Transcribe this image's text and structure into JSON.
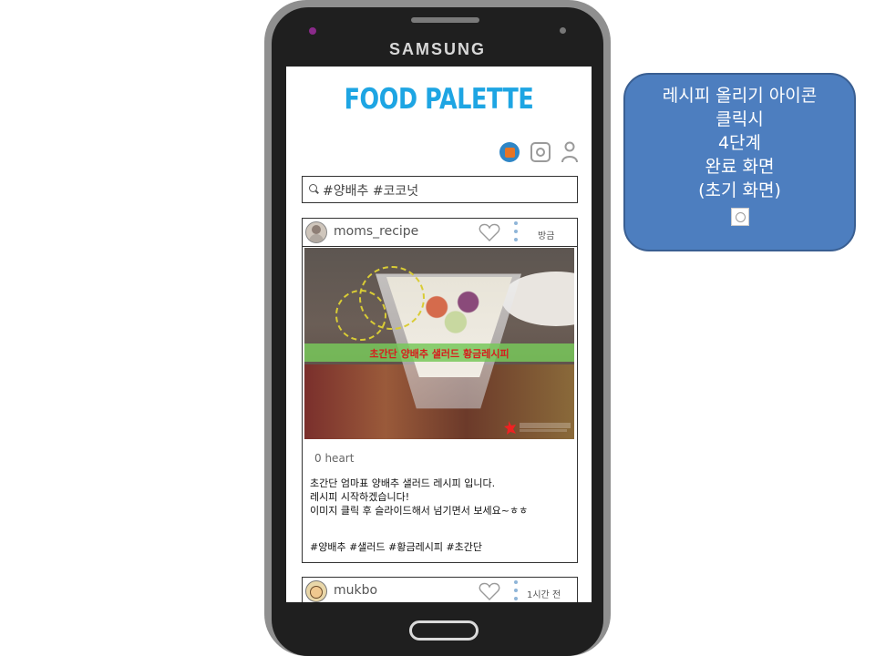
{
  "device": {
    "brand": "SAMSUNG"
  },
  "app": {
    "logo": "FOOD PALETTE",
    "search": {
      "value": "#양배추 #코코넛"
    },
    "icons": [
      "upload-icon",
      "instagram-icon",
      "person-icon"
    ]
  },
  "posts": [
    {
      "user": "moms_recipe",
      "time": "방금",
      "image_banner": "초간단 양배추 샐러드 황금레시피",
      "likes": "0 heart",
      "desc": "초간단 엄마표 양배추 샐러드 레시피 입니다.\n레시피 시작하겠습니다!\n이미지 클릭 후 슬라이드해서 넘기면서 보세요~ㅎㅎ",
      "tags": "#양배추 #샐러드 #황금레시피 #초간단"
    },
    {
      "user": "mukbo",
      "time": "1시간 전"
    }
  ],
  "callout": {
    "lines": [
      "레시피 올리기 아이콘",
      "클릭시",
      "4단계",
      "완료 화면",
      "(초기 화면)"
    ],
    "icon": "instagram-icon"
  },
  "colors": {
    "logo": "#1ea5e3",
    "callout_bg": "#4d7ebf",
    "upload_accent": "#e77424"
  }
}
